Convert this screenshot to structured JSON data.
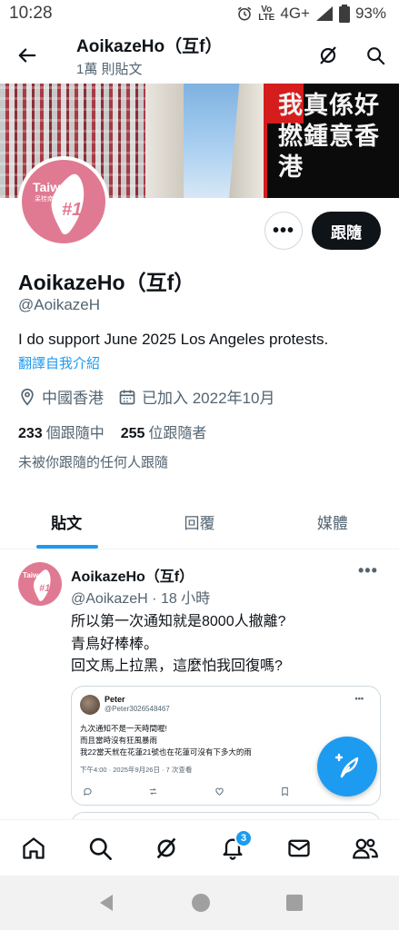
{
  "status_bar": {
    "time": "10:28",
    "network": "4G+",
    "battery": "93%"
  },
  "header": {
    "name": "AoikazeHo（互f）",
    "post_count": "1萬 則貼文"
  },
  "banner": {
    "slogan": "我真係好撚鍾意香港"
  },
  "avatar": {
    "title": "Taiwa",
    "subtitle": "呆桂南波萬",
    "badge_text": "#1"
  },
  "profile": {
    "follow_label": "跟隨",
    "more_label": "•••",
    "name": "AoikazeHo（互f）",
    "handle": "@AoikazeH",
    "bio": "I do support June 2025 Los Angeles protests.",
    "translate_label": "翻譯自我介紹",
    "location": "中國香港",
    "joined": "已加入 2022年10月",
    "following_count": "233",
    "following_label": "個跟隨中",
    "followers_count": "255",
    "followers_label": "位跟隨者",
    "followed_by": "未被你跟隨的任何人跟隨"
  },
  "tabs": [
    {
      "label": "貼文",
      "active": true
    },
    {
      "label": "回覆",
      "active": false
    },
    {
      "label": "媒體",
      "active": false
    }
  ],
  "post": {
    "name": "AoikazeHo（互f）",
    "meta": "@AoikazeH · 18 小時",
    "more_label": "•••",
    "lines": [
      "所以第一次通知就是8000人撤離?",
      "青鳥好棒棒。",
      "回文馬上拉黑，這麼怕我回復嗎?"
    ],
    "quote": {
      "name": "Peter",
      "handle": "@Peter3026548467",
      "more_label": "•••",
      "lines": [
        "九次通知不是一天時間喔!",
        "而且當時沒有狂風暴雨",
        "我22當天就在花蓮21號也在花蓮可沒有下多大的雨"
      ],
      "time": "下午4:00 · 2025年9月26日 · 7 次查看"
    }
  },
  "bottom_nav": {
    "notifications_badge": "3"
  },
  "colors": {
    "accent": "#1d9bf0",
    "text": "#0f1419",
    "secondary_text": "#536471",
    "avatar_pink": "#e07a92"
  }
}
